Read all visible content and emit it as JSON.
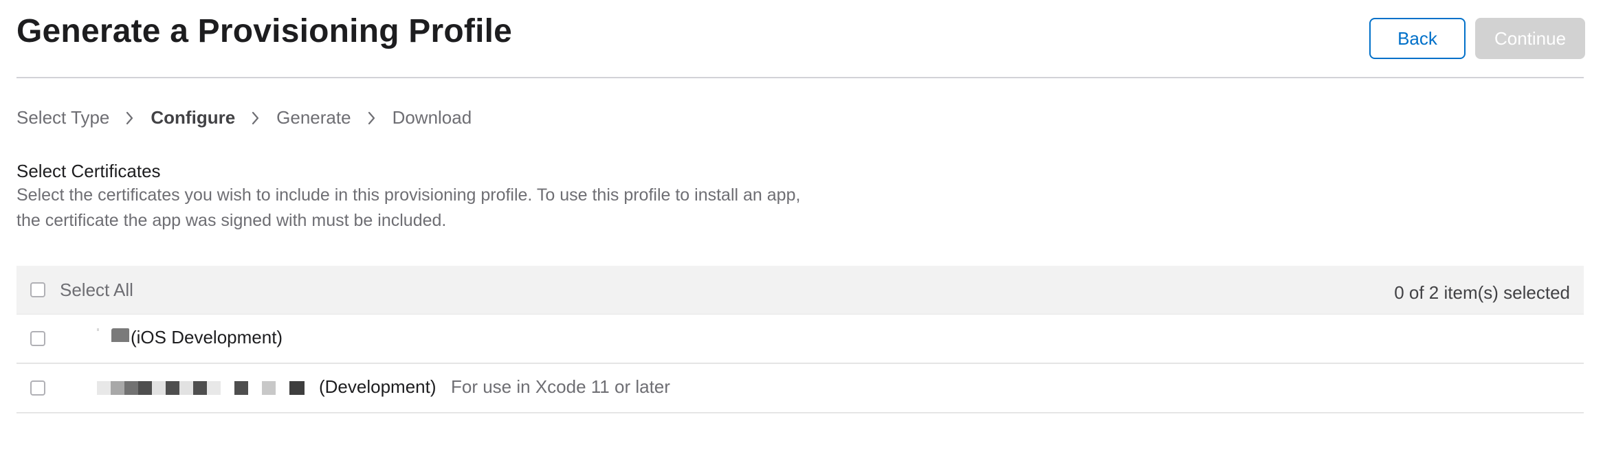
{
  "header": {
    "title": "Generate a Provisioning Profile",
    "back_label": "Back",
    "continue_label": "Continue"
  },
  "breadcrumb": {
    "steps": [
      "Select Type",
      "Configure",
      "Generate",
      "Download"
    ],
    "current_index": 1
  },
  "certificates": {
    "title": "Select Certificates",
    "description_line1": "Select the certificates you wish to include in this provisioning profile. To use this profile to install an app,",
    "description_line2": "the certificate the app was signed with must be included.",
    "select_all_label": "Select All",
    "selected_count": "0 of 2 item(s) selected",
    "items": [
      {
        "name": "(iOS Development)",
        "note": "",
        "checked": false
      },
      {
        "name": "(Development)",
        "note": "For use in Xcode 11 or later",
        "checked": false
      }
    ]
  },
  "colors": {
    "accent": "#0070c9",
    "disabled_button": "#d2d2d2",
    "table_header_bg": "#f2f2f2"
  },
  "icons": [
    "chevron-right-icon"
  ]
}
